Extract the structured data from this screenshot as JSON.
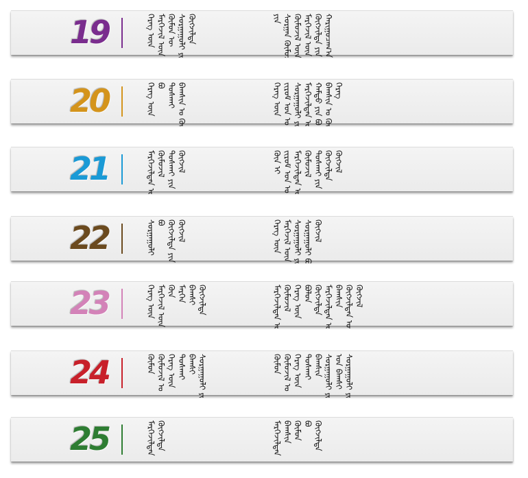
{
  "rows": [
    {
      "number": "19",
      "color": "#7a2d8e",
      "left_col": [
        "ᠬᠡᠷᠡᠭ ᠦᠨ",
        "ᠮᠡᠷᠭᠡᠵᠢᠯ ᠦᠨ",
        "ᠬᠦᠮᠦᠨ ᠦ",
        "ᠰᠤᠷᠭᠠᠭᠤᠯᠢ ᠶᠢᠨ",
        "ᠬᠦᠭᠵᠢᠯᠲᠡ"
      ],
      "right_col": [
        "ᠶᠢᠨ",
        "ᠰᠤᠷᠭᠠᠨ ᠬᠥᠮᠦᠵᠢᠯ ᠤᠨ",
        "ᠬᠦᠮᠦᠵᠢᠯ ᠦᠨ",
        "ᠮᠡᠷᠭᠡᠵᠢᠯ ᠦᠨ",
        "ᠬᠦᠭᠵᠢᠯᠲᠡ ᠶᠢᠨ",
        "ᠬᠠᠷᠢᠭᠤᠴᠠᠭ᠎ᠠ"
      ]
    },
    {
      "number": "20",
      "color": "#d4941c",
      "left_col": [
        "ᠬᠡᠷᠡᠭ ᠦᠨ",
        "ᠪᠤ",
        "ᠲᠤᠰᠬᠠᠢ",
        "ᠪᠠᠭᠰᠢᠨ ᠤ ᠬᠥᠭᠵᠢᠯ"
      ],
      "right_col": [
        "ᠬᠡᠷᠡᠭ ᠦᠨ",
        "ᠵᠢᠷᠤᠮ ᠤᠨ ᠤ",
        "ᠰᠤᠷᠭᠠᠭᠤᠯᠢ ᠶᠢᠨ",
        "ᠮᠡᠷᠭᠡᠵᠢᠯᠲᠡᠨ ᠦ",
        "ᠬᠠᠮᠲᠤ ᠶᠢᠨ ᠪᠤ",
        "ᠪᠠᠭᠰᠢᠨ ᠤ ᠬᠥᠭᠵᠢᠯ",
        "ᠬᠡᠷᠡᠭ"
      ]
    },
    {
      "number": "21",
      "color": "#1a9ad6",
      "left_col": [
        "ᠮᠡᠷᠭᠡᠵᠢᠯᠲᠡᠨ ᠦ ᠰᠤᠷᠭᠠᠯᠲᠠ",
        "ᠬᠦᠮᠦᠵᠢᠯ",
        "ᠲᠤᠰᠬᠠᠢ ᠶᠢᠨ",
        "ᠬᠦᠭᠵᠢᠯ"
      ],
      "right_col": [
        "ᠬᠦᠨ ᠢ",
        "ᠵᠢᠷᠤᠮ ᠤᠨ ᠤ",
        "ᠮᠡᠷᠭᠡᠵᠢᠯᠲᠡᠨ ᠦ ᠰᠤᠷᠭᠠᠯᠲᠠ",
        "ᠬᠦᠮᠦᠵᠢᠯ",
        "ᠲᠤᠰᠬᠠᠢ ᠶᠢᠨ",
        "ᠬᠥᠭᠵᠢᠯᠲᠡ",
        "ᠬᠦᠭᠵᠢᠯ"
      ]
    },
    {
      "number": "22",
      "color": "#6b4a1e",
      "left_col": [
        "ᠰᠤᠷᠭᠠᠭᠤᠯᠢ",
        "ᠪᠤ",
        "ᠬᠥᠭᠵᠢᠯᠲᠡ ᠶᠢᠨ ᠤ",
        "ᠬᠦᠭᠵᠢᠯ"
      ],
      "right_col": [
        "ᠬᠡᠷᠡᠭ ᠦᠨ",
        "ᠮᠡᠷᠭᠡᠵᠢᠯ ᠦᠨ",
        "ᠰᠤᠷᠭᠠᠭᠤᠯᠢ ᠶᠢᠨ ᠬᠥᠭᠵᠢᠯ ᠪᠤ",
        "ᠰᠤᠷᠭᠠᠭᠤᠯᠢ ᠪᠤ",
        "ᠬᠦᠭᠵᠢᠯ"
      ]
    },
    {
      "number": "23",
      "color": "#d382b8",
      "left_col": [
        "ᠬᠡᠷᠡᠭ ᠦᠨ",
        "ᠮᠡᠷᠭᠡᠵᠢᠯ ᠦᠨ",
        "ᠬᠦᠨ",
        "ᠮᠡᠷᠭᠡᠨ",
        "ᠪᠠᠭᠰᠢ",
        "ᠬᠥᠭᠵᠢᠯᠲᠡ"
      ],
      "right_col": [
        "ᠮᠡᠷᠭᠡᠵᠢᠯᠲᠡᠨ ᠦ ᠬᠥᠭᠵᠢᠯ ᠦ",
        "ᠬᠦᠮᠦᠵᠢᠯ",
        "ᠬᠡᠷᠡᠭ ᠦᠨ",
        "ᠪᠤᠯᠤᠨ",
        "ᠬᠦᠭᠵᠢᠯᠲᠡ",
        "ᠮᠡᠷᠭᠡᠵᠢᠯᠲᠡᠨ ᠦ",
        "ᠪᠠᠭᠰᠢᠨ",
        "ᠬᠥᠭᠵᠢᠯᠲᠡᠨ ᠦ",
        "ᠬᠦᠭᠵᠢᠯ"
      ]
    },
    {
      "number": "24",
      "color": "#c8202a",
      "left_col": [
        "ᠬᠦᠮᠦᠨ",
        "ᠬᠦᠮᠦᠵᠢᠯ ᠤ",
        "ᠬᠡᠷᠡᠭ ᠦᠨ",
        "ᠲᠤᠰᠬᠠᠢ",
        "ᠪᠠᠭᠰᠢ",
        "ᠰᠤᠷᠭᠠᠭᠤᠯᠢ ᠶᠢᠨ"
      ],
      "right_col": [
        "ᠬᠦᠮᠦᠨ",
        "ᠬᠦᠮᠦᠵᠢᠯ ᠤ",
        "ᠬᠡᠷᠡᠭ ᠦᠨ",
        "ᠲᠤᠰᠬᠠᠢ",
        "ᠪᠠᠭᠰᠢᠨ",
        "ᠰᠤᠷᠭᠠᠭᠤᠯᠢ ᠶᠢᠨ ᠬᠥᠭᠵᠢᠯ",
        "ᠤᠨ ᠪᠠᠭᠰᠢ",
        "ᠰᠤᠷᠭᠠᠭᠤᠯᠢ ᠶᠢᠨ"
      ]
    },
    {
      "number": "25",
      "color": "#2e7d32",
      "left_col": [
        "ᠮᠡᠷᠭᠡᠵᠢᠯᠲᠡᠨ",
        "ᠬᠥᠭᠵᠢᠯᠲᠡ"
      ],
      "right_col": [
        "ᠮᠡᠷᠭᠡᠵᠢᠯᠲᠡᠨ",
        "ᠪᠠᠭᠰᠢᠨ",
        "ᠬᠦᠮᠦᠨ",
        "ᠪᠤ",
        "ᠬᠥᠭᠵᠢᠯᠲᠡ"
      ]
    }
  ]
}
